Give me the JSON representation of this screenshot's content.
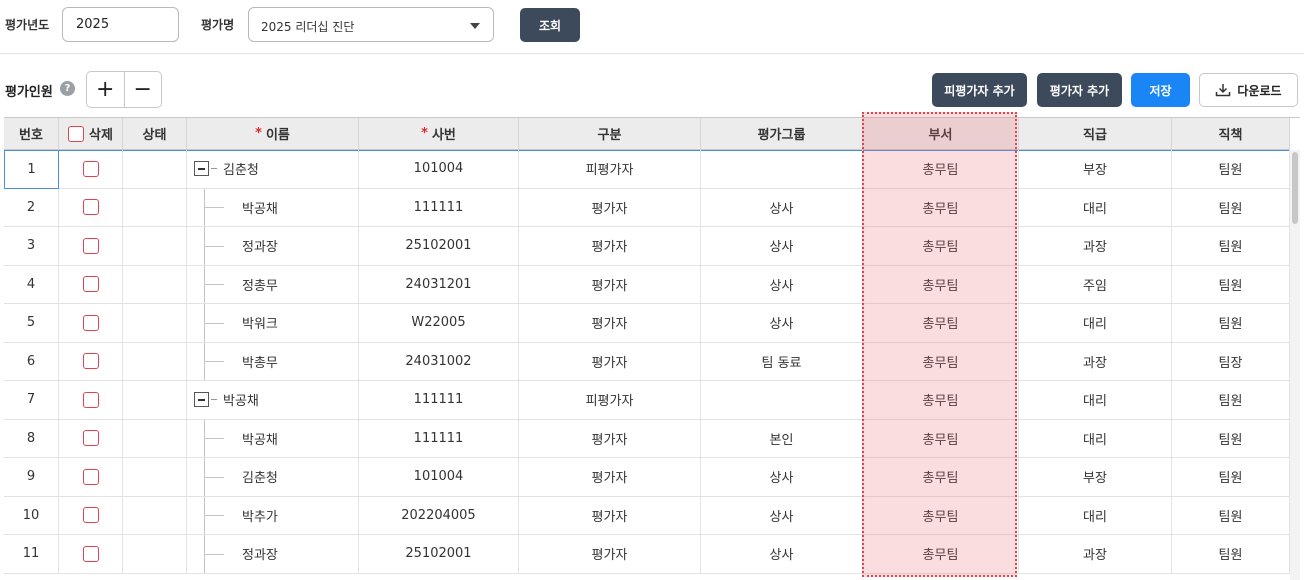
{
  "filter": {
    "year_label": "평가년도",
    "year_value": "2025",
    "name_label": "평가명",
    "name_value": "2025 리더십 진단",
    "search_label": "조회"
  },
  "toolbar": {
    "title": "평가인원",
    "help_glyph": "?",
    "add_glyph": "+",
    "remove_glyph": "−",
    "add_evaluatee_label": "피평가자 추가",
    "add_evaluator_label": "평가자 추가",
    "save_label": "저장",
    "download_label": "다운로드"
  },
  "columns": {
    "no": "번호",
    "delete": "삭제",
    "status": "상태",
    "name": "이름",
    "emp_id": "사번",
    "type": "구분",
    "group": "평가그룹",
    "dept": "부서",
    "rank": "직급",
    "position": "직책",
    "required_mark": "*"
  },
  "rows": [
    {
      "no": "1",
      "name": "김춘청",
      "emp_id": "101004",
      "type": "피평가자",
      "group": "",
      "dept": "총무팀",
      "rank": "부장",
      "position": "팀원",
      "parent": true
    },
    {
      "no": "2",
      "name": "박공채",
      "emp_id": "111111",
      "type": "평가자",
      "group": "상사",
      "dept": "총무팀",
      "rank": "대리",
      "position": "팀원",
      "parent": false
    },
    {
      "no": "3",
      "name": "정과장",
      "emp_id": "25102001",
      "type": "평가자",
      "group": "상사",
      "dept": "총무팀",
      "rank": "과장",
      "position": "팀원",
      "parent": false
    },
    {
      "no": "4",
      "name": "정총무",
      "emp_id": "24031201",
      "type": "평가자",
      "group": "상사",
      "dept": "총무팀",
      "rank": "주임",
      "position": "팀원",
      "parent": false
    },
    {
      "no": "5",
      "name": "박워크",
      "emp_id": "W22005",
      "type": "평가자",
      "group": "상사",
      "dept": "총무팀",
      "rank": "대리",
      "position": "팀원",
      "parent": false
    },
    {
      "no": "6",
      "name": "박총무",
      "emp_id": "24031002",
      "type": "평가자",
      "group": "팀 동료",
      "dept": "총무팀",
      "rank": "과장",
      "position": "팀장",
      "parent": false
    },
    {
      "no": "7",
      "name": "박공채",
      "emp_id": "111111",
      "type": "피평가자",
      "group": "",
      "dept": "총무팀",
      "rank": "대리",
      "position": "팀원",
      "parent": true
    },
    {
      "no": "8",
      "name": "박공채",
      "emp_id": "111111",
      "type": "평가자",
      "group": "본인",
      "dept": "총무팀",
      "rank": "대리",
      "position": "팀원",
      "parent": false
    },
    {
      "no": "9",
      "name": "김춘청",
      "emp_id": "101004",
      "type": "평가자",
      "group": "상사",
      "dept": "총무팀",
      "rank": "부장",
      "position": "팀원",
      "parent": false
    },
    {
      "no": "10",
      "name": "박추가",
      "emp_id": "202204005",
      "type": "평가자",
      "group": "상사",
      "dept": "총무팀",
      "rank": "대리",
      "position": "팀원",
      "parent": false
    },
    {
      "no": "11",
      "name": "정과장",
      "emp_id": "25102001",
      "type": "평가자",
      "group": "상사",
      "dept": "총무팀",
      "rank": "과장",
      "position": "팀원",
      "parent": false
    }
  ]
}
